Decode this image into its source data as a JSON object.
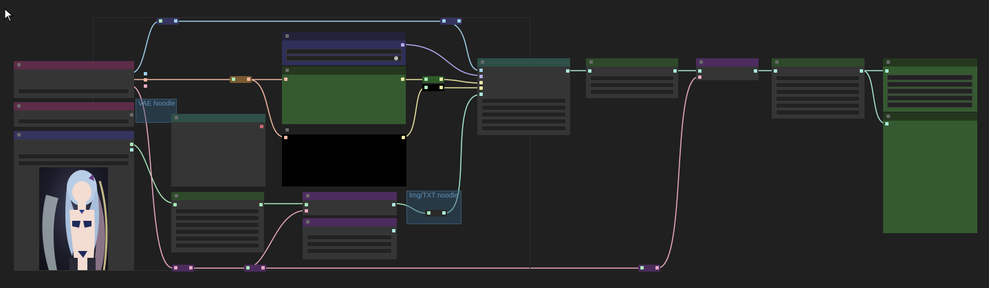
{
  "cursor": {
    "icon": "pointer-arrow-icon"
  },
  "canvas": {
    "background": "#202020"
  },
  "annotations": {
    "vae_noodle": "VAE Noodle",
    "img_txt_noodle": "Img/TXT noodle"
  },
  "colors": {
    "wire_blue": "#9fd0e8",
    "wire_salmon": "#f0b8a0",
    "wire_purple": "#b8a8f0",
    "wire_yellow": "#e8e4a0",
    "wire_green": "#a8e8b8",
    "wire_pink": "#e8a8c0",
    "wire_mint": "#a8e8d8",
    "node_pink": "#5c2c48",
    "node_indigo": "#35345e",
    "node_green": "#2e4a2a",
    "node_teal": "#2e5048",
    "node_purple": "#4c2c5e"
  },
  "image_preview": {
    "icon": "anime-character-image-preview"
  }
}
